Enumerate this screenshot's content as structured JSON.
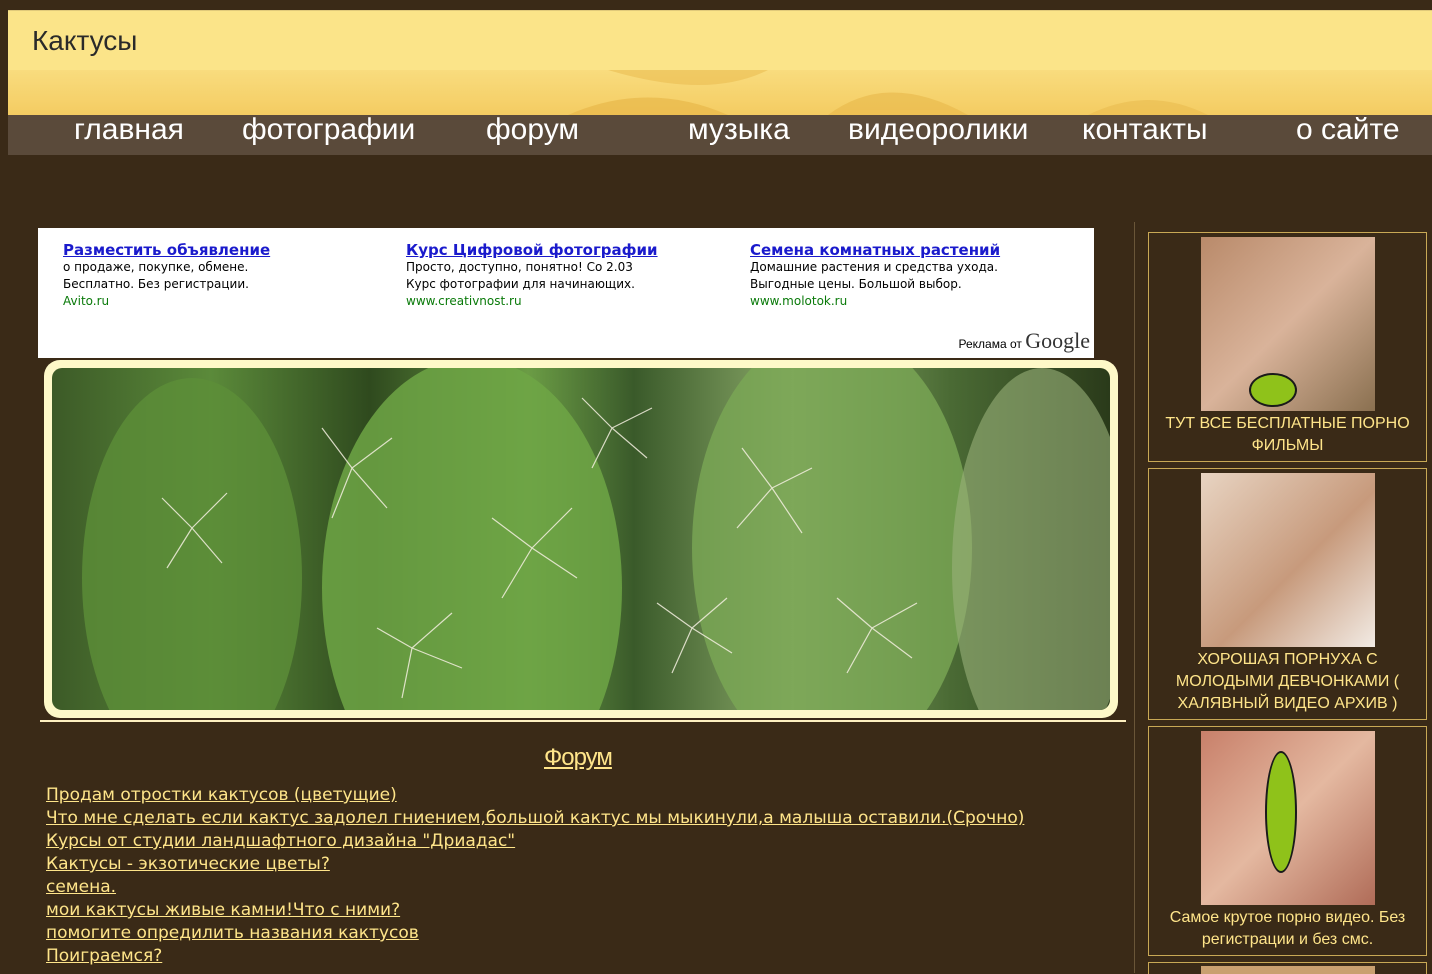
{
  "header": {
    "site_title": "Кактусы"
  },
  "nav": {
    "items": [
      {
        "label": "главная"
      },
      {
        "label": "фотографии"
      },
      {
        "label": "форум"
      },
      {
        "label": "музыка"
      },
      {
        "label": "видеоролики"
      },
      {
        "label": "контакты"
      },
      {
        "label": "о сайте"
      }
    ]
  },
  "ads": {
    "items": [
      {
        "title": "Разместить объявление",
        "line1": "о продаже, покупке, обмене.",
        "line2": "Бесплатно. Без регистрации.",
        "url": "Avito.ru"
      },
      {
        "title": "Курс Цифровой фотографии",
        "line1": "Просто, доступно, понятно! Со 2.03",
        "line2": "Курс фотографии для начинающих.",
        "url": "www.creativnost.ru"
      },
      {
        "title": "Семена комнатных растений",
        "line1": "Домашние растения и средства ухода.",
        "line2": "Выгодные цены. Большой выбор.",
        "url": "www.molotok.ru"
      }
    ],
    "label_prefix": "Реклама от",
    "label_brand": "Google"
  },
  "forum": {
    "heading": "Форум",
    "topics": [
      "Продам отростки кактусов (цветущие)",
      "Что мне сделать если кактус задолел гниением,большой кактус мы мыкинули,а малыша оставили.(Срочно)",
      "Курсы от студии ландшафтного дизайна \"Дриадас\"",
      "Кактусы - экзотические цветы?",
      "семена.",
      "мои кактусы живые камни!Что с ними?",
      "помогите опредилить названия кактусов",
      "Поиграемся?"
    ]
  },
  "sidebar": {
    "cards": [
      {
        "caption": "ТУТ ВСЕ БЕСПЛАТНЫЕ ПОРНО ФИЛЬМЫ"
      },
      {
        "caption": "ХОРОШАЯ ПОРНУХА С МОЛОДЫМИ ДЕВЧОНКАМИ ( ХАЛЯВНЫЙ ВИДЕО АРХИВ )"
      },
      {
        "caption": "Самое крутое порно видео. Без регистрации и без смс."
      }
    ]
  },
  "colors": {
    "background": "#3a2a17",
    "header": "#fbe489",
    "nav_bar": "#5a4a3a",
    "link": "#ffe58a",
    "blob": "#8fc21a"
  }
}
